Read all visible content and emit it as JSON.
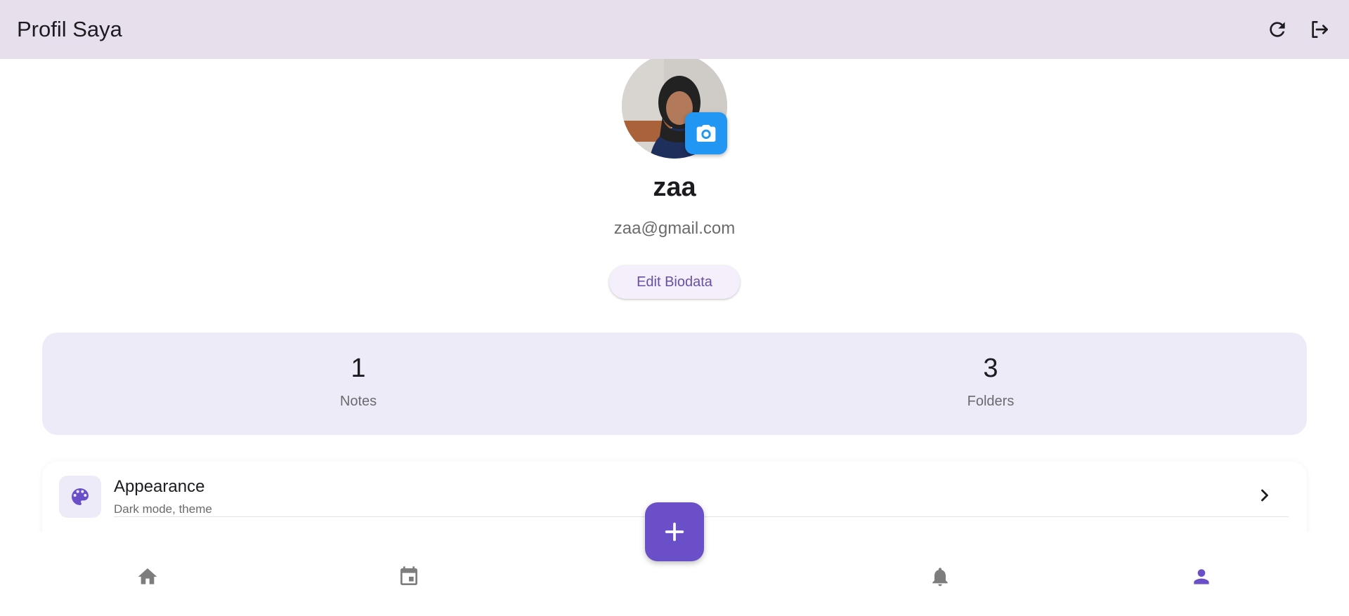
{
  "appbar": {
    "title": "Profil Saya",
    "refresh_icon": "refresh-icon",
    "logout_icon": "logout-icon"
  },
  "profile": {
    "name": "zaa",
    "email": "zaa@gmail.com",
    "edit_label": "Edit Biodata",
    "camera_icon": "camera-icon"
  },
  "stats": [
    {
      "value": "1",
      "label": "Notes"
    },
    {
      "value": "3",
      "label": "Folders"
    }
  ],
  "settings": [
    {
      "icon": "palette-icon",
      "title": "Appearance",
      "subtitle": "Dark mode, theme"
    }
  ],
  "bottom_nav": [
    {
      "icon": "home-icon",
      "active": false
    },
    {
      "icon": "calendar-icon",
      "active": false
    },
    {
      "icon": "bell-icon",
      "active": false
    },
    {
      "icon": "person-icon",
      "active": true
    }
  ],
  "colors": {
    "appbar_bg": "#e7e0ec",
    "accent": "#6a4fc8",
    "camera_button": "#2196f3",
    "stats_bg": "#eeebf9",
    "nav_inactive": "#7d7d7d"
  }
}
